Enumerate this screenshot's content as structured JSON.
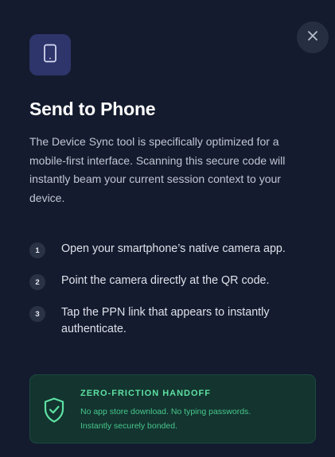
{
  "modal": {
    "title": "Send to Phone",
    "description": "The Device Sync tool is specifically optimized for a mobile-first interface. Scanning this secure code will instantly beam your current session context to your device.",
    "close_icon": "close-icon",
    "device_icon": "smartphone-icon"
  },
  "steps": [
    {
      "number": "1",
      "text": "Open your smartphone’s native camera app."
    },
    {
      "number": "2",
      "text": "Point the camera directly at the QR code."
    },
    {
      "number": "3",
      "text": "Tap the PPN link that appears to instantly authenticate."
    }
  ],
  "handoff": {
    "title": "ZERO-FRICTION HANDOFF",
    "line1": "No app store download. No typing passwords.",
    "line2": "Instantly securely bonded.",
    "icon": "shield-check-icon"
  },
  "colors": {
    "background": "#141b2e",
    "accent_green": "#5ee0a2",
    "device_tile": "#2e356b"
  }
}
